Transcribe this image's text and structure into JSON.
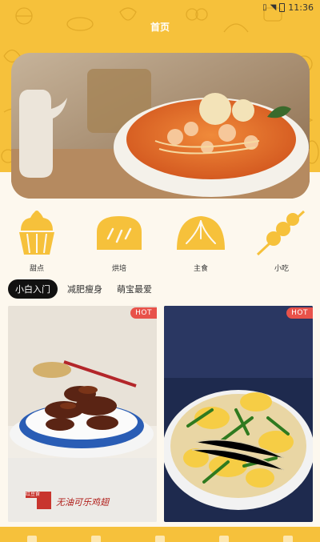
{
  "status": {
    "time": "11:36"
  },
  "header": {
    "title": "首页"
  },
  "categories": [
    {
      "label": "甜点",
      "icon": "cupcake-icon"
    },
    {
      "label": "烘培",
      "icon": "bread-icon"
    },
    {
      "label": "主食",
      "icon": "bun-icon"
    },
    {
      "label": "小吃",
      "icon": "skewer-icon"
    }
  ],
  "tabs": [
    {
      "label": "小白入门",
      "active": true
    },
    {
      "label": "减肥瘦身",
      "active": false
    },
    {
      "label": "萌宝最爱",
      "active": false
    }
  ],
  "cards": [
    {
      "badge": "HOT",
      "caption": "无油可乐鸡翅",
      "stamp": "红豆食"
    },
    {
      "badge": "HOT"
    }
  ],
  "colors": {
    "accent": "#f6c13b",
    "hot": "#e8524a",
    "background": "#fdf8ee"
  }
}
